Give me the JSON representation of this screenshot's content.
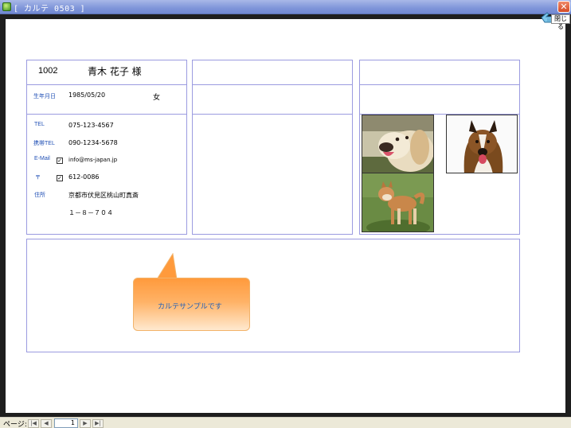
{
  "window": {
    "title": "[ カルテ 0503 ]"
  },
  "close_button": {
    "label": "閉じる"
  },
  "patient": {
    "id": "1002",
    "name": "青木 花子 様",
    "birth_label": "生年月日",
    "birth_date": "1985/05/20",
    "gender": "女",
    "tel_label": "TEL",
    "tel": "075-123-4567",
    "mobile_label": "携帯TEL",
    "mobile": "090-1234-5678",
    "email_label": "E-Mail",
    "email_checked": true,
    "email": "info@ms-japan.jp",
    "postal_label": "〒",
    "postal_checked": true,
    "postal": "612-0086",
    "address_label": "住所",
    "address_line1": "京都市伏見区桃山町真斎",
    "address_line2": "１－８－７０４"
  },
  "callout": {
    "text": "カルテサンプルです"
  },
  "statusbar": {
    "page_label": "ページ:",
    "current_page": "1",
    "nav": {
      "first": "|◀",
      "prev": "◀",
      "next": "▶",
      "last": "▶|"
    }
  },
  "icons": [
    "app-icon",
    "close-icon",
    "hand-icon",
    "checkbox-icon"
  ]
}
